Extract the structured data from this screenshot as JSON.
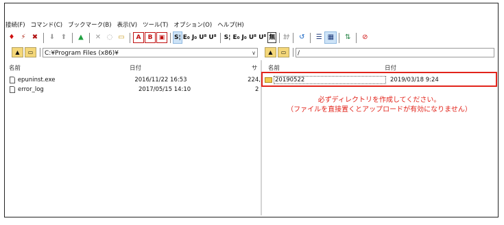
{
  "menu": [
    "接続(F)",
    "コマンド(C)",
    "ブックマーク(B)",
    "表示(V)",
    "ツール(T)",
    "オプション(O)",
    "ヘルプ(H)"
  ],
  "toolbar": {
    "items": [
      {
        "icon": "connect-icon",
        "glyph": "♦",
        "color": "#d01010"
      },
      {
        "icon": "quick-connect-icon",
        "glyph": "⚡",
        "color": "#b03020"
      },
      {
        "icon": "disconnect-icon",
        "glyph": "✖",
        "color": "#b01010"
      },
      {
        "sep": true
      },
      {
        "icon": "download-icon",
        "glyph": "⬇",
        "color": "#a0a0a0"
      },
      {
        "icon": "upload-icon",
        "glyph": "⬆",
        "color": "#a0a0a0"
      },
      {
        "sep": true
      },
      {
        "icon": "parent-folder-icon",
        "glyph": "▲",
        "color": "#20a040"
      },
      {
        "sep": true
      },
      {
        "icon": "delete-icon",
        "glyph": "✕",
        "color": "#9a9a9a"
      },
      {
        "icon": "rename-icon",
        "glyph": "◌",
        "color": "#9a9a9a"
      },
      {
        "icon": "mkdir-icon",
        "glyph": "▭",
        "color": "#c89a20"
      },
      {
        "sep": true
      },
      {
        "icon": "ascii-mode-icon",
        "glyph": "A",
        "color": "#c01010",
        "box": true
      },
      {
        "icon": "binary-mode-icon",
        "glyph": "B",
        "color": "#c01010",
        "box": true
      },
      {
        "icon": "auto-mode-icon",
        "glyph": "▣",
        "color": "#c01010",
        "box": true
      },
      {
        "sep": true
      },
      {
        "icon": "kanji-sjis-icon",
        "text": "S¦",
        "selected": true
      },
      {
        "icon": "kanji-euc-icon",
        "text": "E₀"
      },
      {
        "icon": "kanji-jis-icon",
        "text": "J₀"
      },
      {
        "icon": "kanji-utf8n-icon",
        "text": "U⁸"
      },
      {
        "icon": "kanji-utf8-icon",
        "text": "U⁸"
      },
      {
        "sep": true
      },
      {
        "icon": "local-kanji-sjis-icon",
        "text": "S¦"
      },
      {
        "icon": "local-kanji-euc-icon",
        "text": "E₀"
      },
      {
        "icon": "local-kanji-jis-icon",
        "text": "J₀"
      },
      {
        "icon": "local-kanji-utf8n-icon",
        "text": "U⁸"
      },
      {
        "icon": "local-kanji-utf8-icon",
        "text": "U⁸"
      },
      {
        "icon": "no-convert-icon",
        "text": "無",
        "box": true
      },
      {
        "sep": true
      },
      {
        "icon": "kana-convert-icon",
        "text": "ｶﾅ",
        "color": "#9a9a9a"
      },
      {
        "sep": true
      },
      {
        "icon": "refresh-icon",
        "glyph": "↺",
        "color": "#1060c0"
      },
      {
        "sep": true
      },
      {
        "icon": "list-view-icon",
        "glyph": "☰",
        "color": "#1f3a7a"
      },
      {
        "icon": "detail-view-icon",
        "glyph": "▦",
        "color": "#1f3a7a",
        "selected": true
      },
      {
        "sep": true
      },
      {
        "icon": "sync-icon",
        "glyph": "⇅",
        "color": "#208040"
      },
      {
        "sep": true
      },
      {
        "icon": "stop-icon",
        "glyph": "⊘",
        "color": "#d01010"
      }
    ]
  },
  "local": {
    "path": "C:¥Program Files (x86)¥",
    "col_name": "名前",
    "col_date": "日付",
    "col_size": "サ",
    "files": [
      {
        "name": "epuninst.exe",
        "date": "2016/11/22 16:53",
        "size": "224,"
      },
      {
        "name": "error_log",
        "date": "2017/05/15 14:10",
        "size": "2"
      }
    ]
  },
  "remote": {
    "path": "/",
    "col_name": "名前",
    "col_date": "日付",
    "files": [
      {
        "name": "20190522",
        "date": "2019/03/18  9:24"
      }
    ]
  },
  "annotation": {
    "line1": "必ずディレクトリを作成してください。",
    "line2": "（ファイルを直接置くとアップロードが有効になりません）",
    "color": "#e2231a"
  }
}
